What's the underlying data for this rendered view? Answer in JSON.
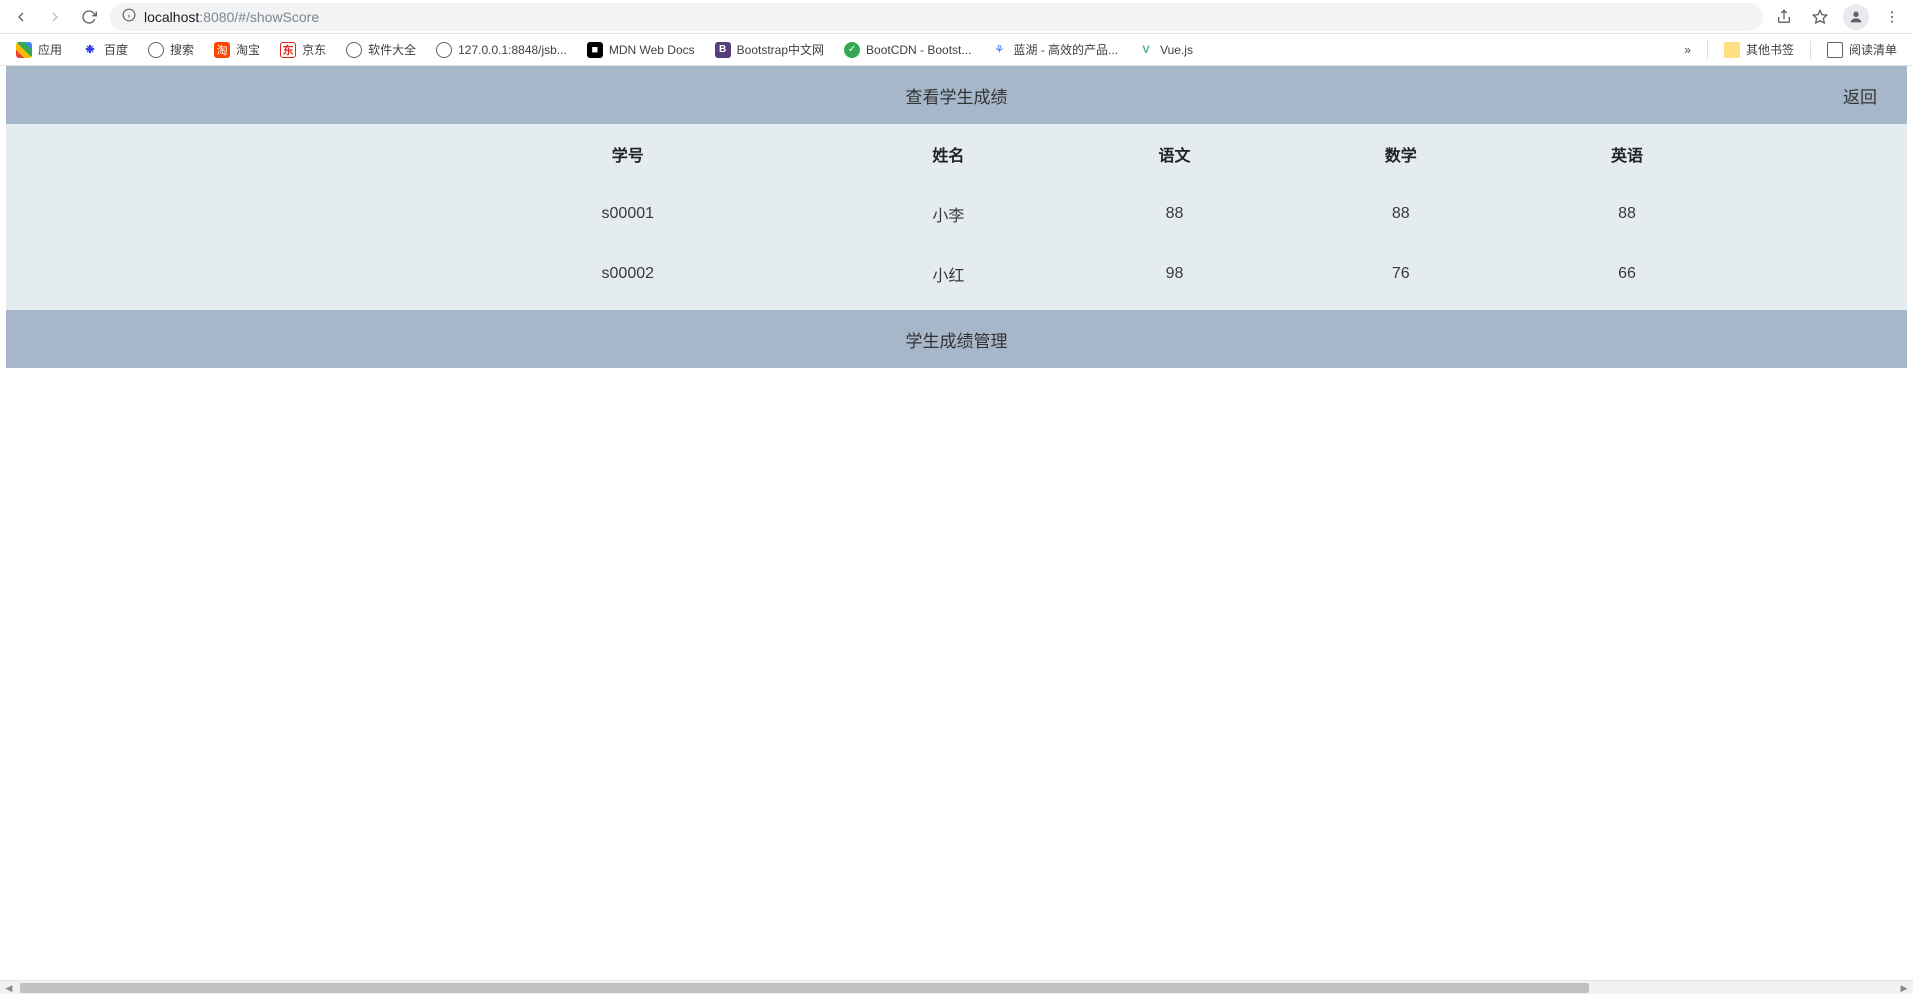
{
  "browser": {
    "url_host": "localhost",
    "url_port_path": ":8080/#/showScore",
    "share_tooltip": "Share",
    "star_tooltip": "Bookmark",
    "profile_tooltip": "Profile",
    "menu_tooltip": "Menu"
  },
  "bookmarks": {
    "apps": "应用",
    "items": [
      {
        "label": "百度"
      },
      {
        "label": "搜索"
      },
      {
        "label": "淘宝"
      },
      {
        "label": "京东"
      },
      {
        "label": "软件大全"
      },
      {
        "label": "127.0.0.1:8848/jsb..."
      },
      {
        "label": "MDN Web Docs"
      },
      {
        "label": "Bootstrap中文网"
      },
      {
        "label": "BootCDN - Bootst..."
      },
      {
        "label": "蓝湖 - 高效的产品..."
      },
      {
        "label": "Vue.js"
      }
    ],
    "more": "»",
    "other": "其他书签",
    "reading_list": "阅读清单"
  },
  "page": {
    "header_title": "查看学生成绩",
    "back_label": "返回",
    "footer_title": "学生成绩管理",
    "columns": [
      "学号",
      "姓名",
      "语文",
      "数学",
      "英语"
    ],
    "rows": [
      {
        "id": "s00001",
        "name": "小李",
        "chinese": "88",
        "math": "88",
        "english": "88"
      },
      {
        "id": "s00002",
        "name": "小红",
        "chinese": "98",
        "math": "76",
        "english": "66"
      }
    ]
  }
}
